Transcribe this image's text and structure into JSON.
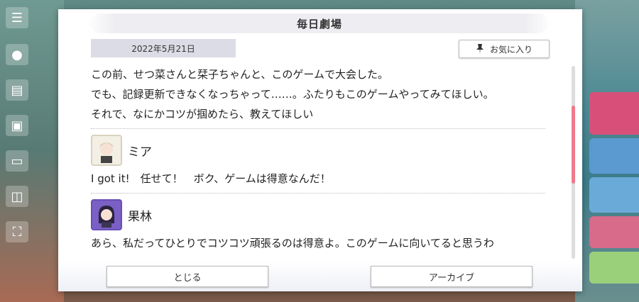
{
  "colors": {
    "accent": "#f07a8a",
    "dialog_bg": "#ffffff",
    "title_bar": "#eeeef2",
    "date_bg": "#dcdce6"
  },
  "dialog": {
    "title": "毎日劇場",
    "date": "2022年5月21日",
    "favorite_label": "お気に入り",
    "favorite_icon": "pin-icon"
  },
  "story": {
    "intro_lines": [
      "この前、せつ菜さんと栞子ちゃんと、このゲームで大会した。",
      "でも、記録更新できなくなっちゃって……。ふたりもこのゲームやってみてほしい。",
      "それで、なにかコツが掴めたら、教えてほしい"
    ],
    "entries": [
      {
        "speaker": "ミア",
        "line": "I got it!　任せて！　ボク、ゲームは得意なんだ！"
      },
      {
        "speaker": "果林",
        "line": "あら、私だってひとりでコツコツ頑張るのは得意よ。このゲームに向いてると思うわ"
      }
    ]
  },
  "footer": {
    "close_label": "とじる",
    "archive_label": "アーカイブ"
  }
}
